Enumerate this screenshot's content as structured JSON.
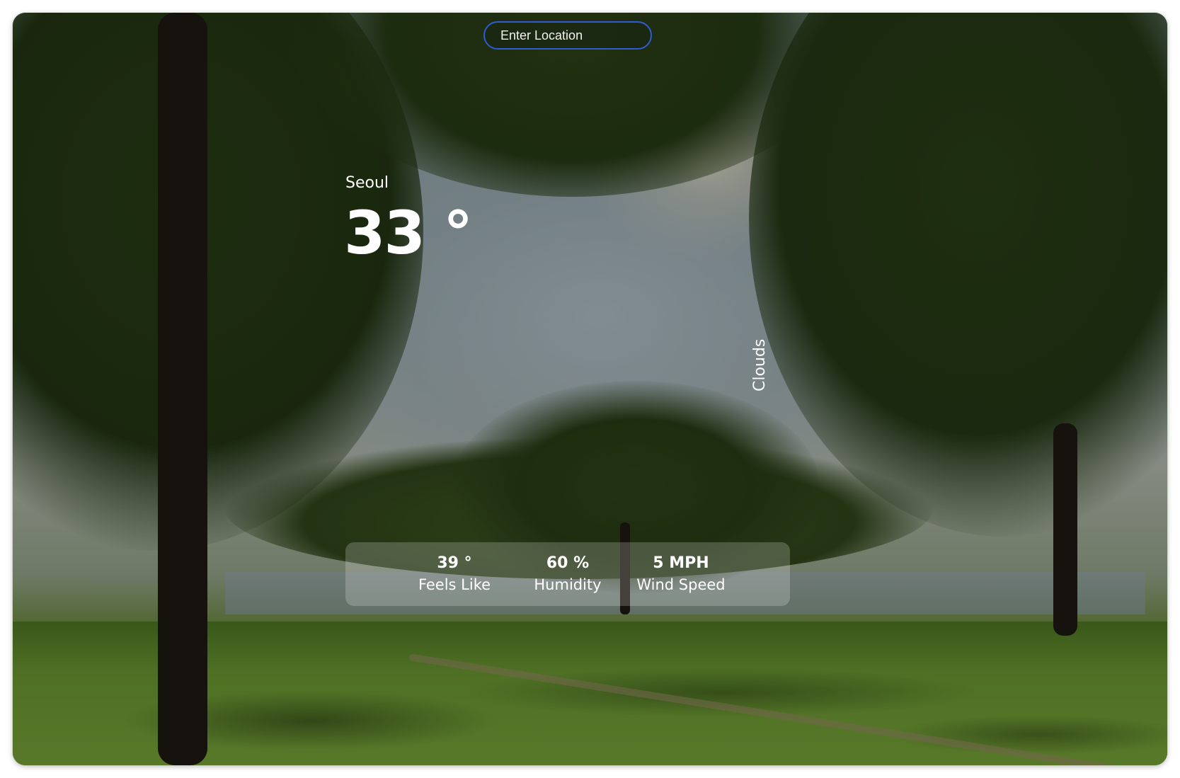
{
  "search": {
    "placeholder": "Enter Location"
  },
  "weather": {
    "city": "Seoul",
    "temperature": "33 °",
    "condition": "Clouds"
  },
  "stats": [
    {
      "value": "39 °",
      "label": "Feels Like"
    },
    {
      "value": "60 %",
      "label": "Humidity"
    },
    {
      "value": "5 MPH",
      "label": "Wind Speed"
    }
  ],
  "background": {
    "icon": "park-photo-background"
  }
}
